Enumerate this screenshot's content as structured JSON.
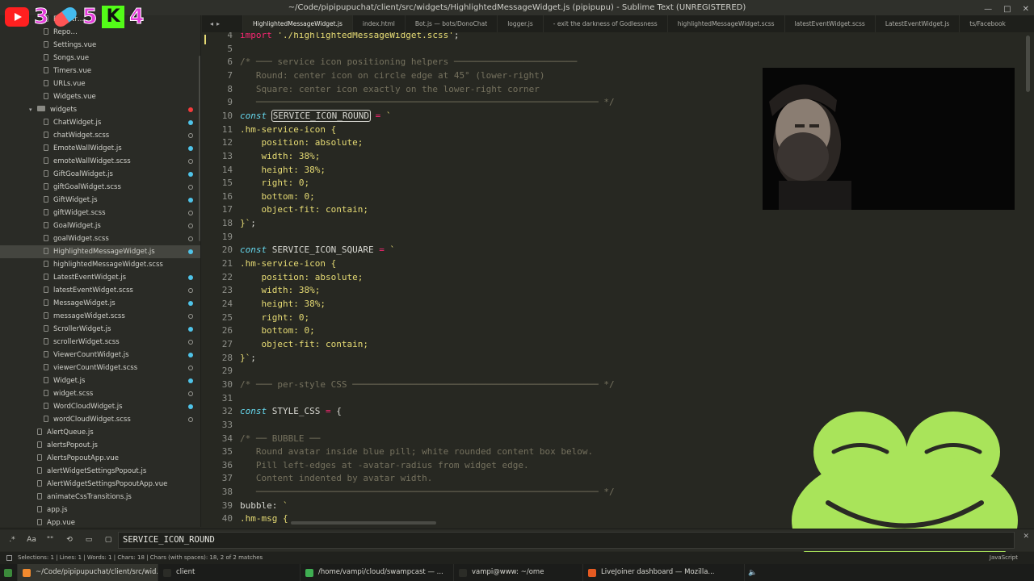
{
  "window": {
    "title": "~/Code/pipipupuchat/client/src/widgets/HighlightedMessageWidget.js (pipipupu) - Sublime Text (UNREGISTERED)"
  },
  "overlay": {
    "youtube_count": "3",
    "pill_count": "5",
    "kick_count": "4",
    "kick_letter": "K"
  },
  "sidebar": {
    "items": [
      {
        "label": "Registr…",
        "type": "file",
        "indent": 1,
        "dot": "none"
      },
      {
        "label": "Repo…",
        "type": "file",
        "indent": 1,
        "dot": "none"
      },
      {
        "label": "Settings.vue",
        "type": "file",
        "indent": 1,
        "dot": "none"
      },
      {
        "label": "Songs.vue",
        "type": "file",
        "indent": 1,
        "dot": "none"
      },
      {
        "label": "Timers.vue",
        "type": "file",
        "indent": 1,
        "dot": "none"
      },
      {
        "label": "URLs.vue",
        "type": "file",
        "indent": 1,
        "dot": "none"
      },
      {
        "label": "Widgets.vue",
        "type": "file",
        "indent": 1,
        "dot": "none"
      },
      {
        "label": "widgets",
        "type": "folder",
        "indent": 0,
        "dot": "red"
      },
      {
        "label": "ChatWidget.js",
        "type": "file",
        "indent": 1,
        "dot": "mod"
      },
      {
        "label": "chatWidget.scss",
        "type": "file",
        "indent": 1,
        "dot": "hollow"
      },
      {
        "label": "EmoteWallWidget.js",
        "type": "file",
        "indent": 1,
        "dot": "mod"
      },
      {
        "label": "emoteWallWidget.scss",
        "type": "file",
        "indent": 1,
        "dot": "hollow"
      },
      {
        "label": "GiftGoalWidget.js",
        "type": "file",
        "indent": 1,
        "dot": "mod"
      },
      {
        "label": "giftGoalWidget.scss",
        "type": "file",
        "indent": 1,
        "dot": "hollow"
      },
      {
        "label": "GiftWidget.js",
        "type": "file",
        "indent": 1,
        "dot": "mod"
      },
      {
        "label": "giftWidget.scss",
        "type": "file",
        "indent": 1,
        "dot": "hollow"
      },
      {
        "label": "GoalWidget.js",
        "type": "file",
        "indent": 1,
        "dot": "hollow"
      },
      {
        "label": "goalWidget.scss",
        "type": "file",
        "indent": 1,
        "dot": "hollow"
      },
      {
        "label": "HighlightedMessageWidget.js",
        "type": "file",
        "indent": 1,
        "dot": "mod",
        "selected": true
      },
      {
        "label": "highlightedMessageWidget.scss",
        "type": "file",
        "indent": 1,
        "dot": "none"
      },
      {
        "label": "LatestEventWidget.js",
        "type": "file",
        "indent": 1,
        "dot": "mod"
      },
      {
        "label": "latestEventWidget.scss",
        "type": "file",
        "indent": 1,
        "dot": "hollow"
      },
      {
        "label": "MessageWidget.js",
        "type": "file",
        "indent": 1,
        "dot": "mod"
      },
      {
        "label": "messageWidget.scss",
        "type": "file",
        "indent": 1,
        "dot": "hollow"
      },
      {
        "label": "ScrollerWidget.js",
        "type": "file",
        "indent": 1,
        "dot": "mod"
      },
      {
        "label": "scrollerWidget.scss",
        "type": "file",
        "indent": 1,
        "dot": "hollow"
      },
      {
        "label": "ViewerCountWidget.js",
        "type": "file",
        "indent": 1,
        "dot": "mod"
      },
      {
        "label": "viewerCountWidget.scss",
        "type": "file",
        "indent": 1,
        "dot": "hollow"
      },
      {
        "label": "Widget.js",
        "type": "file",
        "indent": 1,
        "dot": "mod"
      },
      {
        "label": "widget.scss",
        "type": "file",
        "indent": 1,
        "dot": "hollow"
      },
      {
        "label": "WordCloudWidget.js",
        "type": "file",
        "indent": 1,
        "dot": "mod"
      },
      {
        "label": "wordCloudWidget.scss",
        "type": "file",
        "indent": 1,
        "dot": "hollow"
      },
      {
        "label": "AlertQueue.js",
        "type": "file",
        "indent": 0,
        "dot": "none"
      },
      {
        "label": "alertsPopout.js",
        "type": "file",
        "indent": 0,
        "dot": "none"
      },
      {
        "label": "AlertsPopoutApp.vue",
        "type": "file",
        "indent": 0,
        "dot": "none"
      },
      {
        "label": "alertWidgetSettingsPopout.js",
        "type": "file",
        "indent": 0,
        "dot": "none"
      },
      {
        "label": "AlertWidgetSettingsPopoutApp.vue",
        "type": "file",
        "indent": 0,
        "dot": "none"
      },
      {
        "label": "animateCssTransitions.js",
        "type": "file",
        "indent": 0,
        "dot": "none"
      },
      {
        "label": "app.js",
        "type": "file",
        "indent": 0,
        "dot": "none"
      },
      {
        "label": "App.vue",
        "type": "file",
        "indent": 0,
        "dot": "none"
      }
    ]
  },
  "tabs": [
    {
      "label": "HighlightedMessageWidget.js",
      "active": true
    },
    {
      "label": "index.html"
    },
    {
      "label": "Bot.js — bots/DonoChat"
    },
    {
      "label": "logger.js"
    },
    {
      "label": "- exit the darkness of Godlessness"
    },
    {
      "label": "highlightedMessageWidget.scss"
    },
    {
      "label": "latestEventWidget.scss"
    },
    {
      "label": "LatestEventWidget.js"
    },
    {
      "label": "ts/Facebook"
    }
  ],
  "editor": {
    "lines": [
      {
        "n": "4",
        "segs": [
          {
            "t": "import ",
            "c": "op"
          },
          {
            "t": "'./highlightedMessageWidget.scss'",
            "c": "str"
          },
          {
            "t": ";",
            "c": ""
          }
        ]
      },
      {
        "n": "5",
        "segs": []
      },
      {
        "n": "6",
        "segs": [
          {
            "t": "/* ─── service icon positioning helpers ───────────────────────",
            "c": "cm"
          }
        ]
      },
      {
        "n": "7",
        "segs": [
          {
            "t": "   Round: center icon on circle edge at 45° (lower-right)",
            "c": "cm"
          }
        ]
      },
      {
        "n": "8",
        "segs": [
          {
            "t": "   Square: center icon exactly on the lower-right corner",
            "c": "cm"
          }
        ]
      },
      {
        "n": "9",
        "segs": [
          {
            "t": "   ──────────────────────────────────────────────────────────────── */",
            "c": "cm"
          }
        ]
      },
      {
        "n": "10",
        "segs": [
          {
            "t": "const ",
            "c": "kw"
          },
          {
            "t": "SERVICE_ICON_ROUND",
            "c": "sel"
          },
          {
            "t": " = ",
            "c": "op"
          },
          {
            "t": "`",
            "c": "str"
          }
        ]
      },
      {
        "n": "11",
        "segs": [
          {
            "t": ".hm-service-icon {",
            "c": "str"
          }
        ]
      },
      {
        "n": "12",
        "segs": [
          {
            "t": "    position: absolute;",
            "c": "str"
          }
        ]
      },
      {
        "n": "13",
        "segs": [
          {
            "t": "    width: 38%;",
            "c": "str"
          }
        ]
      },
      {
        "n": "14",
        "segs": [
          {
            "t": "    height: 38%;",
            "c": "str"
          }
        ]
      },
      {
        "n": "15",
        "segs": [
          {
            "t": "    right: 0;",
            "c": "str"
          }
        ]
      },
      {
        "n": "16",
        "segs": [
          {
            "t": "    bottom: 0;",
            "c": "str"
          }
        ]
      },
      {
        "n": "17",
        "segs": [
          {
            "t": "    object-fit: contain;",
            "c": "str"
          }
        ]
      },
      {
        "n": "18",
        "segs": [
          {
            "t": "}`",
            "c": "str"
          },
          {
            "t": ";",
            "c": ""
          }
        ]
      },
      {
        "n": "19",
        "segs": []
      },
      {
        "n": "20",
        "segs": [
          {
            "t": "const ",
            "c": "kw"
          },
          {
            "t": "SERVICE_ICON_SQUARE",
            "c": ""
          },
          {
            "t": " = ",
            "c": "op"
          },
          {
            "t": "`",
            "c": "str"
          }
        ]
      },
      {
        "n": "21",
        "segs": [
          {
            "t": ".hm-service-icon {",
            "c": "str"
          }
        ]
      },
      {
        "n": "22",
        "segs": [
          {
            "t": "    position: absolute;",
            "c": "str"
          }
        ]
      },
      {
        "n": "23",
        "segs": [
          {
            "t": "    width: 38%;",
            "c": "str"
          }
        ]
      },
      {
        "n": "24",
        "segs": [
          {
            "t": "    height: 38%;",
            "c": "str"
          }
        ]
      },
      {
        "n": "25",
        "segs": [
          {
            "t": "    right: 0;",
            "c": "str"
          }
        ]
      },
      {
        "n": "26",
        "segs": [
          {
            "t": "    bottom: 0;",
            "c": "str"
          }
        ]
      },
      {
        "n": "27",
        "segs": [
          {
            "t": "    object-fit: contain;",
            "c": "str"
          }
        ]
      },
      {
        "n": "28",
        "segs": [
          {
            "t": "}`",
            "c": "str"
          },
          {
            "t": ";",
            "c": ""
          }
        ]
      },
      {
        "n": "29",
        "segs": []
      },
      {
        "n": "30",
        "segs": [
          {
            "t": "/* ─── per-style CSS ────────────────────────────────────────────── */",
            "c": "cm"
          }
        ]
      },
      {
        "n": "31",
        "segs": []
      },
      {
        "n": "32",
        "segs": [
          {
            "t": "const ",
            "c": "kw"
          },
          {
            "t": "STYLE_CSS",
            "c": ""
          },
          {
            "t": " = ",
            "c": "op"
          },
          {
            "t": "{",
            "c": ""
          }
        ]
      },
      {
        "n": "33",
        "segs": []
      },
      {
        "n": "34",
        "segs": [
          {
            "t": "/* ── BUBBLE ──",
            "c": "cm"
          }
        ]
      },
      {
        "n": "35",
        "segs": [
          {
            "t": "   Round avatar inside blue pill; white rounded content box below.",
            "c": "cm"
          }
        ]
      },
      {
        "n": "36",
        "segs": [
          {
            "t": "   Pill left-edges at -avatar-radius from widget edge.",
            "c": "cm"
          }
        ]
      },
      {
        "n": "37",
        "segs": [
          {
            "t": "   Content indented by avatar width.",
            "c": "cm"
          }
        ]
      },
      {
        "n": "38",
        "segs": [
          {
            "t": "   ──────────────────────────────────────────────────────────────── */",
            "c": "cm"
          }
        ]
      },
      {
        "n": "39",
        "segs": [
          {
            "t": "bubble: ",
            "c": ""
          },
          {
            "t": "`",
            "c": "str"
          }
        ]
      },
      {
        "n": "40",
        "segs": [
          {
            "t": ".hm-msg {",
            "c": "str"
          }
        ]
      }
    ]
  },
  "find": {
    "regex_label": ".*",
    "case_label": "Aa",
    "word_label": "\"\"",
    "query": "SERVICE_ICON_ROUND",
    "close_label": "✕"
  },
  "status": {
    "left": "Selections: 1 | Lines: 1 | Words: 1 | Chars: 18 | Chars (with spaces): 18, 2 of 2 matches",
    "right": "JavaScript"
  },
  "taskbar": {
    "items": [
      {
        "label": "~/Code/pipipupuchat/client/src/wid...",
        "color": "#f28a2e",
        "active": true
      },
      {
        "label": "client",
        "color": "#2b2c27"
      },
      {
        "label": "/home/vampi/cloud/swampcast — ...",
        "color": "#3fae52"
      },
      {
        "label": "vampi@www: ~/ome",
        "color": "#2b2c27"
      },
      {
        "label": "LiveJoiner dashboard — Mozilla...",
        "color": "#e55a21"
      }
    ]
  }
}
